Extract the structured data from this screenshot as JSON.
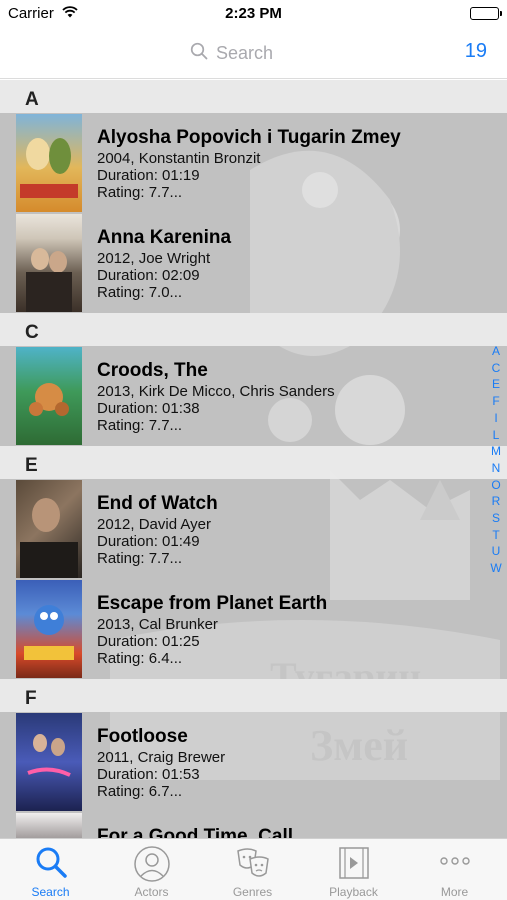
{
  "status": {
    "carrier": "Carrier",
    "time": "2:23 PM"
  },
  "nav": {
    "search_placeholder": "Search",
    "count": "19"
  },
  "sections": [
    {
      "letter": "A",
      "movies": [
        {
          "title": "Alyosha Popovich i Tugarin Zmey",
          "meta": "2004, Konstantin Bronzit",
          "duration": "Duration: 01:19",
          "rating": "Rating: 7.7..."
        },
        {
          "title": "Anna Karenina",
          "meta": "2012, Joe Wright",
          "duration": "Duration: 02:09",
          "rating": "Rating: 7.0..."
        }
      ]
    },
    {
      "letter": "C",
      "movies": [
        {
          "title": "Croods, The",
          "meta": "2013, Kirk De Micco, Chris Sanders",
          "duration": "Duration: 01:38",
          "rating": "Rating: 7.7..."
        }
      ]
    },
    {
      "letter": "E",
      "movies": [
        {
          "title": "End of Watch",
          "meta": "2012, David Ayer",
          "duration": "Duration: 01:49",
          "rating": "Rating: 7.7..."
        },
        {
          "title": "Escape from Planet Earth",
          "meta": "2013, Cal Brunker",
          "duration": "Duration: 01:25",
          "rating": "Rating: 6.4..."
        }
      ]
    },
    {
      "letter": "F",
      "movies": [
        {
          "title": "Footloose",
          "meta": "2011, Craig Brewer",
          "duration": "Duration: 01:53",
          "rating": "Rating: 6.7..."
        },
        {
          "title": "For a Good Time, Call...",
          "meta": "",
          "duration": "",
          "rating": ""
        }
      ]
    }
  ],
  "index_letters": [
    "A",
    "C",
    "E",
    "F",
    "I",
    "L",
    "M",
    "N",
    "O",
    "R",
    "S",
    "T",
    "U",
    "W"
  ],
  "tabs": [
    {
      "label": "Search",
      "icon": "search-icon"
    },
    {
      "label": "Actors",
      "icon": "actors-icon"
    },
    {
      "label": "Genres",
      "icon": "genres-icon"
    },
    {
      "label": "Playback",
      "icon": "playback-icon"
    },
    {
      "label": "More",
      "icon": "more-icon"
    }
  ],
  "colors": {
    "accent": "#1a7cf5",
    "inactive": "#999999",
    "section_bg": "#eaeaea"
  }
}
